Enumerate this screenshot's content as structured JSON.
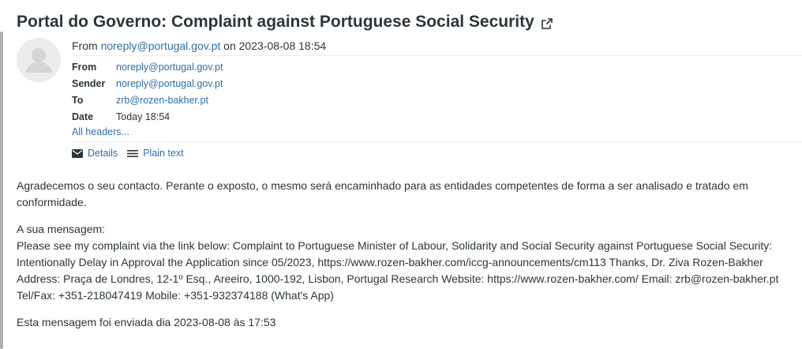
{
  "message": {
    "subject": "Portal do Governo: Complaint against Portuguese Social Security",
    "from_prefix": "From",
    "from_email": "noreply@portugal.gov.pt",
    "on_word": "on",
    "datetime": "2023-08-08 18:54",
    "headers": [
      {
        "key": "From",
        "value": "noreply@portugal.gov.pt",
        "link": true
      },
      {
        "key": "Sender",
        "value": "noreply@portugal.gov.pt",
        "link": true
      },
      {
        "key": "To",
        "value": "zrb@rozen-bakher.pt",
        "link": true
      },
      {
        "key": "Date",
        "value": "Today 18:54",
        "link": false
      }
    ],
    "all_headers": "All headers...",
    "actions": {
      "details": "Details",
      "plain_text": "Plain text"
    },
    "body": {
      "p1": "Agradecemos o seu contacto. Perante o exposto, o mesmo será encaminhado para as entidades competentes de forma a ser analisado e tratado em conformidade.",
      "p2_label": "A sua mensagem:",
      "p2_text": "Please see my complaint via the link below: Complaint to Portuguese Minister of Labour, Solidarity and Social Security against Portuguese Social Security: Intentionally Delay in Approval the Application since 05/2023, https://www.rozen-bakher.com/iccg-announcements/cm113 Thanks, Dr. Ziva Rozen-Bakher Address: Praça de Londres, 12-1º Esq., Areeiro, 1000-192, Lisbon, Portugal Research Website: https://www.rozen-bakher.com/ Email: zrb@rozen-bakher.pt Tel/Fax: +351-218047419 Mobile: +351-932374188 (What's App)",
      "p3": "Esta mensagem foi enviada dia 2023-08-08 às 17:53"
    }
  },
  "icons": {
    "external_link": "external-link-icon",
    "avatar": "avatar-icon",
    "details": "envelope-icon",
    "plain_text": "lines-icon"
  },
  "colors": {
    "link": "#2f6fa8",
    "text": "#2c363a",
    "avatar_bg": "#ececec"
  }
}
